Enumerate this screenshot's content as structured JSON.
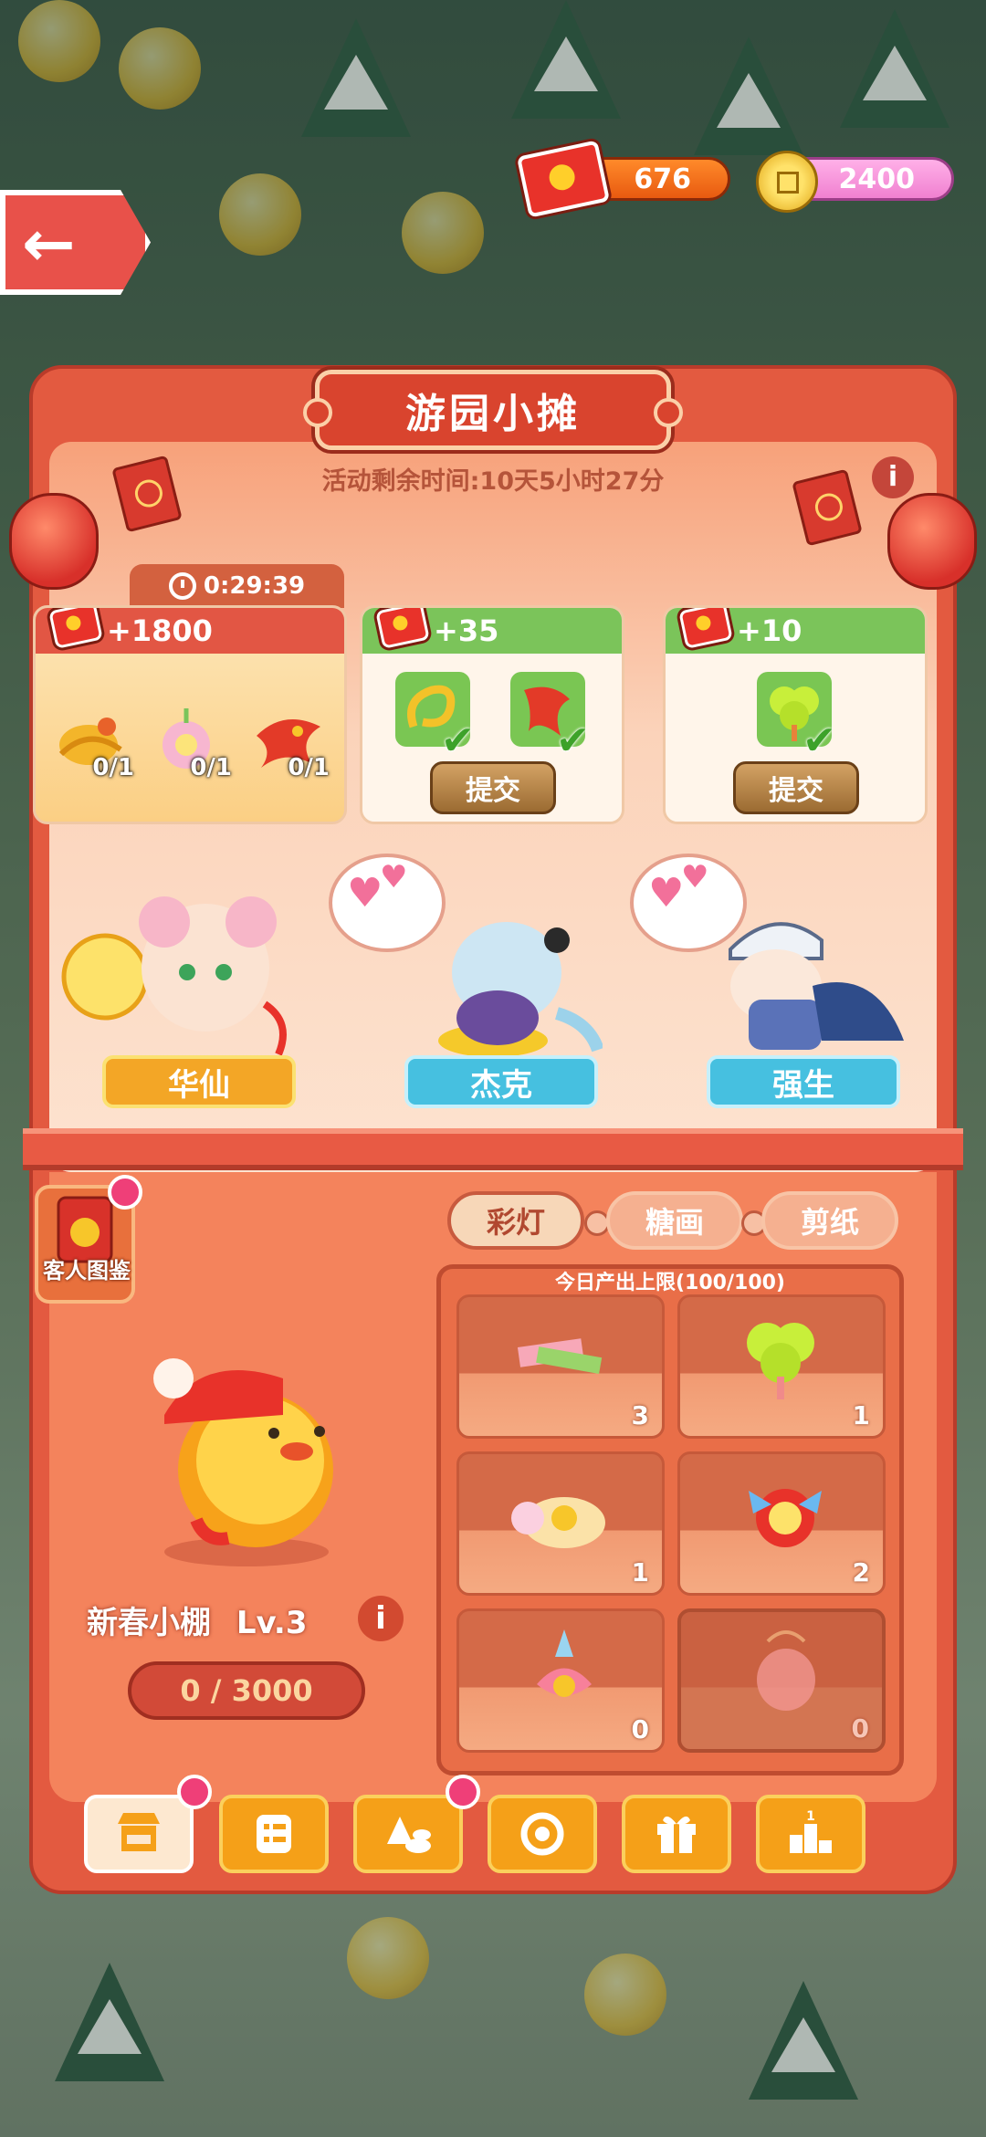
{
  "currency": {
    "tickets": "676",
    "coins": "2400"
  },
  "panel": {
    "title": "游园小摊",
    "time_remaining": "活动剩余时间:10天5小时27分"
  },
  "orders": [
    {
      "timer": "0:29:39",
      "reward": "+1800",
      "items": [
        {
          "icon": "golden-dragon-lantern-icon",
          "count": "0/1"
        },
        {
          "icon": "flower-lantern-icon",
          "count": "0/1"
        },
        {
          "icon": "red-phoenix-icon",
          "count": "0/1"
        }
      ]
    },
    {
      "reward": "+35",
      "items": [
        {
          "icon": "yellow-candy-painting-icon",
          "done": true
        },
        {
          "icon": "red-candy-painting-icon",
          "done": true
        }
      ],
      "submit_label": "提交"
    },
    {
      "reward": "+10",
      "items": [
        {
          "icon": "clover-lantern-icon",
          "done": true
        }
      ],
      "submit_label": "提交"
    }
  ],
  "characters": [
    {
      "name": "华仙"
    },
    {
      "name": "杰克"
    },
    {
      "name": "强生"
    }
  ],
  "guest_guide_label": "客人图鉴",
  "booth": {
    "name": "新春小棚",
    "level": "Lv.3",
    "progress": "0 / 3000"
  },
  "tabs": [
    {
      "label": "彩灯",
      "active": true
    },
    {
      "label": "糖画",
      "active": false
    },
    {
      "label": "剪纸",
      "active": false
    }
  ],
  "production_cap": "今日产出上限(100/100)",
  "products": [
    {
      "icon": "paper-strips-icon",
      "count": "3"
    },
    {
      "icon": "clover-lantern-icon",
      "count": "1"
    },
    {
      "icon": "turtle-lantern-icon",
      "count": "1"
    },
    {
      "icon": "butterfly-lantern-icon",
      "count": "2"
    },
    {
      "icon": "lotus-lantern-icon",
      "count": "0"
    },
    {
      "icon": "pink-lantern-icon",
      "count": "0",
      "locked": true
    }
  ],
  "bottom_nav": [
    {
      "icon": "shop-icon",
      "active": true,
      "badge": true
    },
    {
      "icon": "list-icon",
      "active": false,
      "badge": false
    },
    {
      "icon": "ingredients-icon",
      "active": false,
      "badge": true
    },
    {
      "icon": "spin-icon",
      "active": false,
      "badge": false
    },
    {
      "icon": "gift-icon",
      "active": false,
      "badge": false
    },
    {
      "icon": "ranking-icon",
      "active": false,
      "badge": false
    }
  ],
  "colors": {
    "panel_red": "#e35a40",
    "reward_green": "#7bc45a",
    "tag_gold": "#f3a626",
    "tag_blue": "#46c0e0",
    "nav_orange": "#f5a018",
    "badge_pink": "#ef3f78"
  }
}
